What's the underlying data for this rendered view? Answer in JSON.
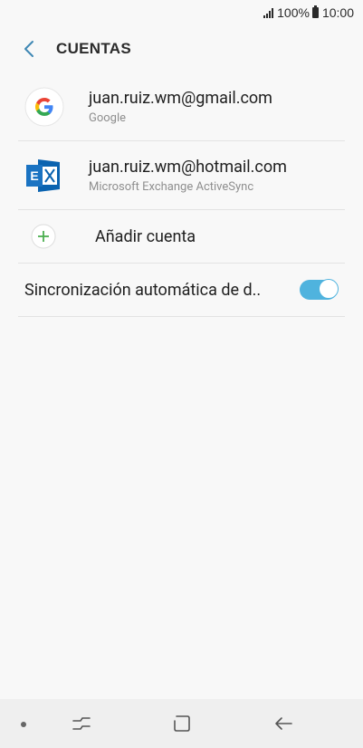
{
  "status_bar": {
    "battery_text": "100%",
    "time": "10:00"
  },
  "header": {
    "title": "CUENTAS"
  },
  "accounts": [
    {
      "email": "juan.ruiz.wm@gmail.com",
      "provider": "Google",
      "icon": "google-icon"
    },
    {
      "email": "juan.ruiz.wm@hotmail.com",
      "provider": "Microsoft Exchange ActiveSync",
      "icon": "exchange-icon"
    }
  ],
  "add_account": {
    "label": "Añadir cuenta"
  },
  "auto_sync": {
    "label": "Sincronización automática de d..",
    "enabled": true
  },
  "colors": {
    "accent": "#4fb3de",
    "add_green": "#4caf50",
    "exchange_blue": "#0a63b0"
  }
}
